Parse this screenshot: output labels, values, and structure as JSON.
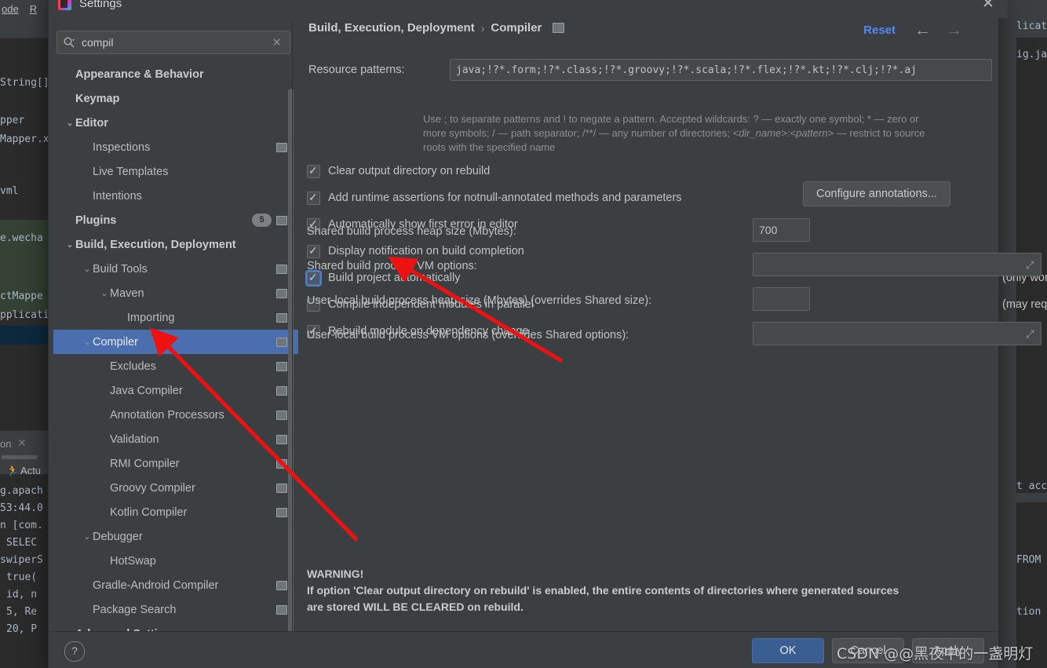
{
  "background": {
    "menu_items": [
      "ode",
      "R"
    ],
    "code_fragments": [
      "String[]):",
      "pper",
      "Mapper.x",
      "vml",
      "e.wecha",
      "ctMappe",
      "pplicatio"
    ],
    "console_tab": "on",
    "console_run_label": "Actu",
    "console_lines": [
      "g.apach",
      "53:44.0",
      "n [com.",
      "SELEC",
      "swiperS",
      "true(",
      "id, n",
      "5, Re",
      "20, P"
    ],
    "right_fragments": [
      "lication",
      "ig.java",
      "t acc",
      "FROM",
      "tion"
    ]
  },
  "dialog": {
    "title": "Settings",
    "close_label": "✕"
  },
  "search": {
    "value": "compil",
    "placeholder": "",
    "clear_label": "✕"
  },
  "tree": {
    "items": [
      {
        "label": "Appearance & Behavior",
        "indent": 0,
        "bold": true,
        "twisty": "",
        "icon": false,
        "badge": "",
        "selected": false
      },
      {
        "label": "Keymap",
        "indent": 0,
        "bold": true,
        "twisty": "",
        "icon": false,
        "badge": "",
        "selected": false
      },
      {
        "label": "Editor",
        "indent": 0,
        "bold": true,
        "twisty": "⌄",
        "icon": false,
        "badge": "",
        "selected": false
      },
      {
        "label": "Inspections",
        "indent": 1,
        "bold": false,
        "twisty": "",
        "icon": true,
        "badge": "",
        "selected": false
      },
      {
        "label": "Live Templates",
        "indent": 1,
        "bold": false,
        "twisty": "",
        "icon": false,
        "badge": "",
        "selected": false
      },
      {
        "label": "Intentions",
        "indent": 1,
        "bold": false,
        "twisty": "",
        "icon": false,
        "badge": "",
        "selected": false
      },
      {
        "label": "Plugins",
        "indent": 0,
        "bold": true,
        "twisty": "",
        "icon": true,
        "badge": "5",
        "selected": false
      },
      {
        "label": "Build, Execution, Deployment",
        "indent": 0,
        "bold": true,
        "twisty": "⌄",
        "icon": false,
        "badge": "",
        "selected": false
      },
      {
        "label": "Build Tools",
        "indent": 1,
        "bold": false,
        "twisty": "⌄",
        "icon": true,
        "badge": "",
        "selected": false
      },
      {
        "label": "Maven",
        "indent": 2,
        "bold": false,
        "twisty": "⌄",
        "icon": true,
        "badge": "",
        "selected": false
      },
      {
        "label": "Importing",
        "indent": 3,
        "bold": false,
        "twisty": "",
        "icon": true,
        "badge": "",
        "selected": false
      },
      {
        "label": "Compiler",
        "indent": 1,
        "bold": false,
        "twisty": "⌄",
        "icon": true,
        "badge": "",
        "selected": true
      },
      {
        "label": "Excludes",
        "indent": 2,
        "bold": false,
        "twisty": "",
        "icon": true,
        "badge": "",
        "selected": false
      },
      {
        "label": "Java Compiler",
        "indent": 2,
        "bold": false,
        "twisty": "",
        "icon": true,
        "badge": "",
        "selected": false
      },
      {
        "label": "Annotation Processors",
        "indent": 2,
        "bold": false,
        "twisty": "",
        "icon": true,
        "badge": "",
        "selected": false
      },
      {
        "label": "Validation",
        "indent": 2,
        "bold": false,
        "twisty": "",
        "icon": true,
        "badge": "",
        "selected": false
      },
      {
        "label": "RMI Compiler",
        "indent": 2,
        "bold": false,
        "twisty": "",
        "icon": true,
        "badge": "",
        "selected": false
      },
      {
        "label": "Groovy Compiler",
        "indent": 2,
        "bold": false,
        "twisty": "",
        "icon": true,
        "badge": "",
        "selected": false
      },
      {
        "label": "Kotlin Compiler",
        "indent": 2,
        "bold": false,
        "twisty": "",
        "icon": true,
        "badge": "",
        "selected": false
      },
      {
        "label": "Debugger",
        "indent": 1,
        "bold": false,
        "twisty": "⌄",
        "icon": false,
        "badge": "",
        "selected": false
      },
      {
        "label": "HotSwap",
        "indent": 2,
        "bold": false,
        "twisty": "",
        "icon": false,
        "badge": "",
        "selected": false
      },
      {
        "label": "Gradle-Android Compiler",
        "indent": 1,
        "bold": false,
        "twisty": "",
        "icon": true,
        "badge": "",
        "selected": false
      },
      {
        "label": "Package Search",
        "indent": 1,
        "bold": false,
        "twisty": "",
        "icon": true,
        "badge": "",
        "selected": false
      },
      {
        "label": "Advanced Settings",
        "indent": 0,
        "bold": true,
        "twisty": "",
        "icon": false,
        "badge": "",
        "selected": false
      }
    ]
  },
  "header": {
    "breadcrumb_root": "Build, Execution, Deployment",
    "breadcrumb_sep": "›",
    "breadcrumb_leaf": "Compiler",
    "reset_label": "Reset",
    "back_arrow": "←",
    "forward_arrow": "→"
  },
  "resource_patterns": {
    "label": "Resource patterns:",
    "value": "java;!?*.form;!?*.class;!?*.groovy;!?*.scala;!?*.flex;!?*.kt;!?*.clj;!?*.aj",
    "expand_glyph": "⤢",
    "hint_line1_a": "Use ; to separate patterns and ! to negate a pattern. Accepted wildcards: ? — exactly one symbol; * — zero or",
    "hint_line2_a": "more symbols; / — path separator; /**/ — any number of directories; ",
    "hint_line2_i": "<dir_name>:<pattern>",
    "hint_line2_b": " — restrict to source",
    "hint_line3": "roots with the specified name"
  },
  "checkboxes": [
    {
      "label": "Clear output directory on rebuild",
      "checked": true,
      "focused": false,
      "note": ""
    },
    {
      "label": "Add runtime assertions for notnull-annotated methods and parameters",
      "checked": true,
      "focused": false,
      "note": ""
    },
    {
      "label": "Automatically show first error in editor",
      "checked": true,
      "focused": false,
      "note": ""
    },
    {
      "label": "Display notification on build completion",
      "checked": true,
      "focused": false,
      "note": ""
    },
    {
      "label": "Build project automatically",
      "checked": true,
      "focused": true,
      "note": "(only works while not running / debugging)"
    },
    {
      "label": "Compile independent modules in parallel",
      "checked": false,
      "focused": false,
      "note": "(may require larger heap size)"
    },
    {
      "label": "Rebuild module on dependency change",
      "checked": true,
      "focused": false,
      "note": ""
    }
  ],
  "configure_button": "Configure annotations...",
  "fields": [
    {
      "label": "Shared build process heap size (Mbytes):",
      "value": "700",
      "wide": false
    },
    {
      "label": "Shared build process VM options:",
      "value": "",
      "wide": true
    },
    {
      "label": "User-local build process heap size (Mbytes) (overrides Shared size):",
      "value": "",
      "wide": false
    },
    {
      "label": "User-local build process VM options (overrides Shared options):",
      "value": "",
      "wide": true
    }
  ],
  "warning": {
    "line1": "WARNING!",
    "line2": "If option 'Clear output directory on rebuild' is enabled, the entire contents of directories where generated sources",
    "line3": "are stored WILL BE CLEARED on rebuild."
  },
  "footer": {
    "help_label": "?",
    "ok_label": "OK",
    "cancel_label": "Cancel",
    "apply_label": "Apply"
  },
  "watermark": "CSDN @@黑夜中的一盏明灯",
  "colors": {
    "selection_blue": "#4b6eaf",
    "accent_link": "#548af7",
    "annotation_red": "#ee1111",
    "dialog_bg": "#3c3f41"
  }
}
